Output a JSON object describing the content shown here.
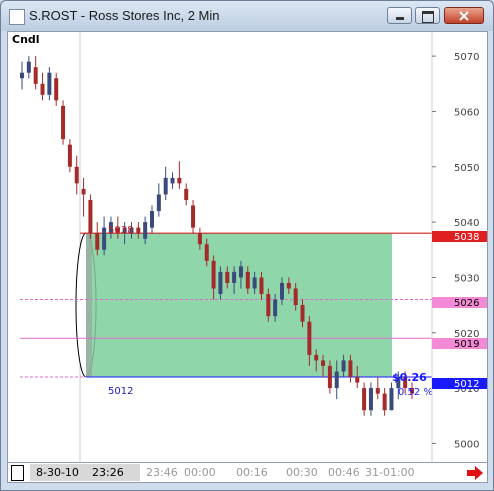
{
  "window": {
    "title": "S.ROST - Ross Stores Inc, 2 Min"
  },
  "colors": {
    "up": "#3a4a7a",
    "down": "#a52a2a",
    "zone": "#7dcf9c",
    "resistance": "#d02020",
    "magenta": "#e06ad0",
    "blue": "#1a1aff"
  },
  "indicator_label": "Cndl",
  "levels": {
    "upper_text": "5038",
    "upper_axis": "5038",
    "mid1_axis": "5026",
    "mid2_axis": "5019",
    "lower_text": "5012",
    "lower_axis": "5012",
    "change_value": "$0.26",
    "change_pct": "0.52 %"
  },
  "chart_data": {
    "type": "candlestick",
    "y_ticks": [
      "5070",
      "5060",
      "5050",
      "5040",
      "5030",
      "5020",
      "5010",
      "5000"
    ],
    "y_tick_values": [
      5070,
      5060,
      5050,
      5040,
      5030,
      5020,
      5010,
      5000
    ],
    "ylim": [
      4997,
      5074
    ],
    "x_labels": [
      "8-30-10",
      "23:26",
      "23:46",
      "00:00",
      "00:16",
      "00:30",
      "00:46",
      "31-01:00"
    ],
    "candles": [
      [
        5066,
        5069,
        5064,
        5067
      ],
      [
        5067,
        5070,
        5066,
        5069
      ],
      [
        5068,
        5070,
        5064,
        5065
      ],
      [
        5065,
        5067,
        5062,
        5063
      ],
      [
        5063,
        5068,
        5062,
        5067
      ],
      [
        5066,
        5067,
        5061,
        5062
      ],
      [
        5061,
        5062,
        5054,
        5055
      ],
      [
        5054,
        5055,
        5049,
        5050
      ],
      [
        5050,
        5052,
        5045,
        5047
      ],
      [
        5046,
        5048,
        5041,
        5045
      ],
      [
        5044,
        5045,
        5037,
        5038
      ],
      [
        5038,
        5040,
        5034,
        5035
      ],
      [
        5035,
        5041,
        5034,
        5039
      ],
      [
        5038,
        5041,
        5037,
        5040
      ],
      [
        5039,
        5041,
        5037,
        5038
      ],
      [
        5038,
        5040,
        5036,
        5039
      ],
      [
        5038,
        5040,
        5037,
        5039
      ],
      [
        5039,
        5040,
        5037,
        5038
      ],
      [
        5037,
        5041,
        5036,
        5040
      ],
      [
        5039,
        5043,
        5038,
        5042
      ],
      [
        5042,
        5047,
        5041,
        5045
      ],
      [
        5045,
        5050,
        5044,
        5048
      ],
      [
        5047,
        5049,
        5046,
        5048
      ],
      [
        5048,
        5051,
        5046,
        5047
      ],
      [
        5046,
        5047,
        5043,
        5044
      ],
      [
        5043,
        5044,
        5038,
        5039
      ],
      [
        5038,
        5039,
        5035,
        5036
      ],
      [
        5036,
        5037,
        5032,
        5033
      ],
      [
        5033,
        5034,
        5026,
        5028
      ],
      [
        5027,
        5032,
        5026,
        5031
      ],
      [
        5031,
        5032,
        5028,
        5029
      ],
      [
        5029,
        5032,
        5027,
        5031
      ],
      [
        5030,
        5033,
        5028,
        5032
      ],
      [
        5031,
        5032,
        5027,
        5028
      ],
      [
        5028,
        5031,
        5027,
        5030
      ],
      [
        5030,
        5031,
        5026,
        5027
      ],
      [
        5027,
        5028,
        5022,
        5023
      ],
      [
        5023,
        5027,
        5022,
        5026
      ],
      [
        5026,
        5030,
        5025,
        5029
      ],
      [
        5029,
        5030,
        5027,
        5028
      ],
      [
        5028,
        5029,
        5024,
        5025
      ],
      [
        5025,
        5026,
        5021,
        5022
      ],
      [
        5022,
        5023,
        5014,
        5016
      ],
      [
        5016,
        5017,
        5013,
        5015
      ],
      [
        5015,
        5016,
        5012,
        5014
      ],
      [
        5014,
        5015,
        5009,
        5010
      ],
      [
        5010,
        5015,
        5008,
        5013
      ],
      [
        5013,
        5016,
        5012,
        5015
      ],
      [
        5015,
        5016,
        5011,
        5012
      ],
      [
        5012,
        5014,
        5010,
        5011
      ],
      [
        5010,
        5011,
        5005,
        5006
      ],
      [
        5006,
        5011,
        5005,
        5010
      ],
      [
        5010,
        5012,
        5008,
        5009
      ],
      [
        5009,
        5010,
        5005,
        5006
      ],
      [
        5006,
        5011,
        5006,
        5010
      ],
      [
        5010,
        5013,
        5008,
        5012
      ],
      [
        5012,
        5013,
        5009,
        5010
      ],
      [
        5010,
        5011,
        5008,
        5009
      ]
    ]
  }
}
